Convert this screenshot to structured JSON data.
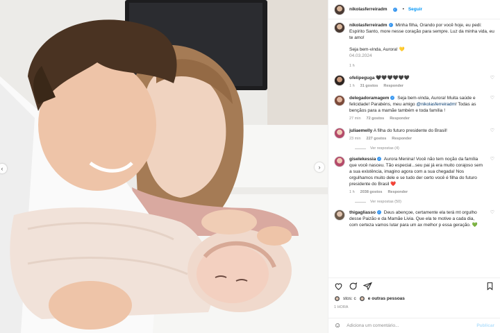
{
  "header": {
    "username": "nikolasferreiradm",
    "follow_label": "Seguir",
    "separator": "•"
  },
  "caption": {
    "username": "nikolasferreiradm",
    "text": "Minha filha, Orando por você hoje, eu pedi: Espírito Santo, more nesse coração para sempre. Luz da minha vida, eu te amo!",
    "line2": "Seja bem-vinda, Aurora! 💛",
    "date": "04.03.2024",
    "time": "1 h"
  },
  "comments": [
    {
      "username": "ofelipeguga",
      "text": "🖤🖤🖤🖤🖤🖤",
      "time": "1 h",
      "likes": "31 gostos",
      "reply": "Responder",
      "replies": ""
    },
    {
      "username": "delegadoramagem",
      "text": "Seja bem-vinda, Aurora! Muita saúde e felicidade! Parabéns, meu amigo",
      "mention": "@nikolasferreiradm",
      "text2": "! Todas as bençãos para a mamãe também e toda família !",
      "time": "27 min",
      "likes": "72 gostos",
      "reply": "Responder",
      "replies": ""
    },
    {
      "username": "juliaemelly",
      "text": "A filha do futuro presidente do Brasil!",
      "time": "23 min",
      "likes": "227 gostos",
      "reply": "Responder",
      "replies": "Ver respostas (4)"
    },
    {
      "username": "giselekessia",
      "text": "Aurora Menina! Você não tem noção da família que você nasceu. Tão especial...seu pai já era muito corajoso sem a sua existência, imagino agora com a sua chegada! Nos orgulhamos muito dele e se tudo der certo você é filha do futuro presidente do Brasil ❤️",
      "time": "1 h",
      "likes": "2038 gostos",
      "reply": "Responder",
      "replies": "Ver respostas (50)"
    },
    {
      "username": "thigagliasso",
      "text": "Deus abençoe, certamente ela terá mt orgulho desse Paizão e da Mamãe Livia. Que ela te motive a cada dia, com certeza vamos lutar para um ax melhor p essa geração. 💚",
      "time": "",
      "likes": "",
      "reply": "",
      "replies": ""
    }
  ],
  "likes_text": "stos: c",
  "likes_suffix": "e outras pessoas",
  "post_time": "1 HORA",
  "add_comment": {
    "placeholder": "Adiciona um comentário...",
    "publish": "Publicar"
  },
  "icons": [
    "heart-icon",
    "comment-icon",
    "share-icon",
    "bookmark-icon",
    "smile-icon",
    "verified-icon",
    "chevron-left-icon",
    "chevron-right-icon"
  ],
  "colors": {
    "accent": "#0095f6",
    "verified": "#3897f0",
    "muted": "#8e8e8e"
  }
}
